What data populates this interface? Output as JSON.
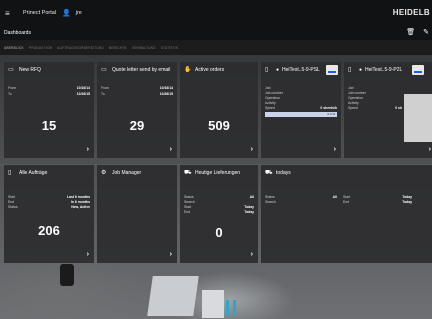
{
  "topbar": {
    "menu_icon": "menu-icon",
    "portal_title": "Prinect Portal",
    "user_icon": "user-icon",
    "user_name": "jre",
    "logo": "HEIDELB"
  },
  "subbar": {
    "title": "Dashboards",
    "icons": [
      "trash-icon",
      "edit-icon"
    ]
  },
  "breadcrumbs": [
    "ÜBERBLICK",
    "PRODUKTION",
    "AUFTRAGSVORBEREITUNG",
    "BERICHTE",
    "VERWALTUNG",
    "STATISTIK"
  ],
  "tiles": {
    "new_rfq": {
      "title": "New RFQ",
      "icon": "inbox-icon",
      "rows": [
        {
          "label": "From",
          "value": "10/16/14"
        },
        {
          "label": "To",
          "value": "10/16/15"
        }
      ],
      "count": "15"
    },
    "quote_letter": {
      "title": "Quote letter send by email",
      "icon": "mail-icon",
      "rows": [
        {
          "label": "From",
          "value": "10/16/14"
        },
        {
          "label": "To",
          "value": "10/26/15"
        }
      ],
      "count": "29"
    },
    "active_orders": {
      "title": "Active orders",
      "icon": "handshake-icon",
      "rows": [],
      "count": "509"
    },
    "heitest_1": {
      "title": "HeiTest..5-9-PSL",
      "icon": "machine-icon",
      "rows": [
        {
          "label": "Job",
          "value": ""
        },
        {
          "label": "Job number",
          "value": ""
        },
        {
          "label": "Operation",
          "value": ""
        },
        {
          "label": "Activity",
          "value": ""
        },
        {
          "label": "Speed",
          "value": "0 sheets/h"
        }
      ],
      "bar_value": "0.0 %"
    },
    "heitest_2": {
      "title": "HeiTest..5-9-P2L",
      "icon": "machine-icon",
      "rows": [
        {
          "label": "Job",
          "value": ""
        },
        {
          "label": "Job number",
          "value": ""
        },
        {
          "label": "Operation",
          "value": ""
        },
        {
          "label": "Activity",
          "value": ""
        },
        {
          "label": "Speed",
          "value": "0 sh"
        }
      ]
    },
    "alle_auftraege": {
      "title": "Alle Aufträge",
      "icon": "document-icon",
      "rows": [
        {
          "label": "Start",
          "value": "Last 6 months"
        },
        {
          "label": "End",
          "value": "In 6 months"
        },
        {
          "label": "Status",
          "value": "New, Active"
        }
      ],
      "count": "206"
    },
    "job_manager": {
      "title": "Job Manager",
      "icon": "gear-icon",
      "rows": []
    },
    "heutige_lieferungen": {
      "title": "Heutige Lieferungen",
      "icon": "truck-icon",
      "rows": [
        {
          "label": "Status",
          "value": "All"
        },
        {
          "label": "Search",
          "value": ""
        },
        {
          "label": "Start",
          "value": "Today"
        },
        {
          "label": "End",
          "value": "Today"
        }
      ],
      "count": "0"
    },
    "todays": {
      "title": "todays",
      "icon": "truck-icon",
      "rows_left": [
        {
          "label": "Status",
          "value": "All"
        },
        {
          "label": "Search",
          "value": ""
        }
      ],
      "rows_right": [
        {
          "label": "Start",
          "value": "Today"
        },
        {
          "label": "End",
          "value": "Today"
        }
      ]
    }
  },
  "chevron": "›"
}
